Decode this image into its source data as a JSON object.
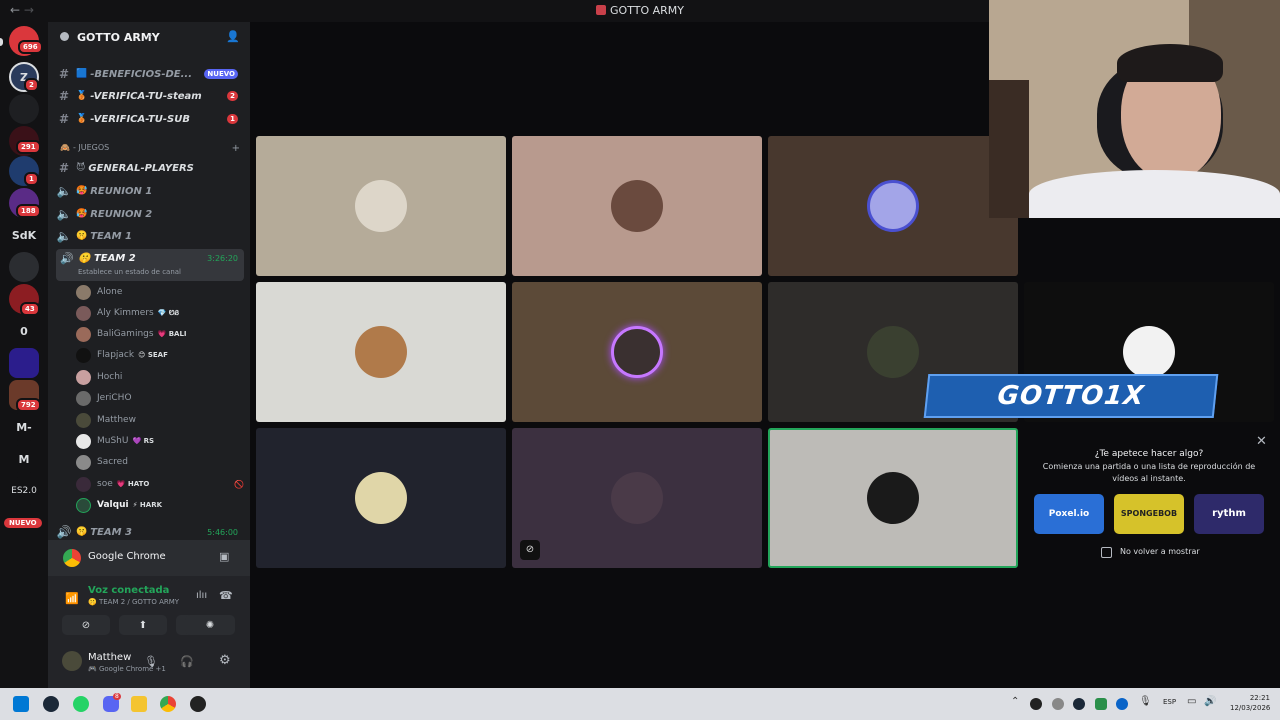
{
  "window": {
    "title": "GOTTO ARMY",
    "nav_back": "←",
    "nav_forward": "→"
  },
  "rail": {
    "servers": [
      {
        "label": "",
        "badge": "696"
      },
      {
        "label": "Z",
        "badge": "2"
      },
      {
        "label": "",
        "badge": ""
      },
      {
        "label": "",
        "badge": "291"
      },
      {
        "label": "",
        "badge": "1"
      },
      {
        "label": "",
        "badge": "188"
      },
      {
        "label": "SdK",
        "badge": ""
      },
      {
        "label": "",
        "badge": ""
      },
      {
        "label": "",
        "badge": "43"
      },
      {
        "label": "0",
        "badge": ""
      },
      {
        "label": "",
        "badge": ""
      },
      {
        "label": "",
        "badge": "792"
      },
      {
        "label": "M-",
        "badge": ""
      },
      {
        "label": "M",
        "badge": ""
      },
      {
        "label": "ES2.0",
        "badge": ""
      }
    ],
    "new_badge": "NUEVO"
  },
  "sidebar": {
    "server_name": "GOTTO ARMY",
    "channels_top": [
      {
        "name": "-BENEFICIOS-DE...",
        "emoji": "🟦",
        "new": "NUEVO",
        "count": ""
      },
      {
        "name": "-VERIFICA-TU-steam",
        "emoji": "🥉",
        "new": "",
        "count": "2"
      },
      {
        "name": "-VERIFICA-TU-SUB",
        "emoji": "🥉",
        "new": "",
        "count": "1"
      }
    ],
    "category": "- JUEGOS",
    "channels_games": [
      {
        "name": "GENERAL-PLAYERS",
        "emoji": "😈"
      },
      {
        "name": "REUNION 1",
        "emoji": "🥵"
      },
      {
        "name": "REUNION 2",
        "emoji": "🥵"
      },
      {
        "name": "TEAM 1",
        "emoji": "🤫"
      }
    ],
    "active_channel": {
      "name": "TEAM 2",
      "emoji": "🤫",
      "time": "3:26:20",
      "status": "Establece un estado de canal"
    },
    "members": [
      {
        "name": "Alone",
        "tag": ""
      },
      {
        "name": "Aly Kimmers",
        "tag": "💎 ᏬᏰ"
      },
      {
        "name": "BaliGamings",
        "tag": "💗 BALI"
      },
      {
        "name": "Flapjack",
        "tag": "😊 SEAF"
      },
      {
        "name": "Hochi",
        "tag": ""
      },
      {
        "name": "JeriCHO",
        "tag": ""
      },
      {
        "name": "Matthew",
        "tag": ""
      },
      {
        "name": "MuShU",
        "tag": "💜 RS"
      },
      {
        "name": "Sacred",
        "tag": ""
      },
      {
        "name": "soe",
        "tag": "💗 HATO"
      },
      {
        "name": "Valqui",
        "tag": "⚡ HARK"
      }
    ],
    "next_channel": {
      "name": "TEAM 3",
      "emoji": "🤫",
      "time": "5:46:00"
    }
  },
  "panel": {
    "app_name": "Google Chrome",
    "voice_status": "Voz conectada",
    "voice_channel": "TEAM 2 / GOTTO ARMY",
    "user_name": "Matthew",
    "user_status": "Google Chrome +1"
  },
  "stream": {
    "banner_text": "GOTTO1X",
    "prompt_title": "¿Te apetece hacer algo?",
    "prompt_body": "Comienza una partida o una lista de reproducción de vídeos al instante.",
    "activities": [
      "Poxel.io",
      "SPONGEBOB",
      "rythm"
    ],
    "dont_show": "No volver a mostrar"
  },
  "taskbar": {
    "lang": "ESP",
    "time": "22:21",
    "date": "12/03/2026",
    "discord_badge": "8"
  },
  "colors": {
    "accent": "#5865f2",
    "green": "#23a55a",
    "red": "#da373c"
  }
}
